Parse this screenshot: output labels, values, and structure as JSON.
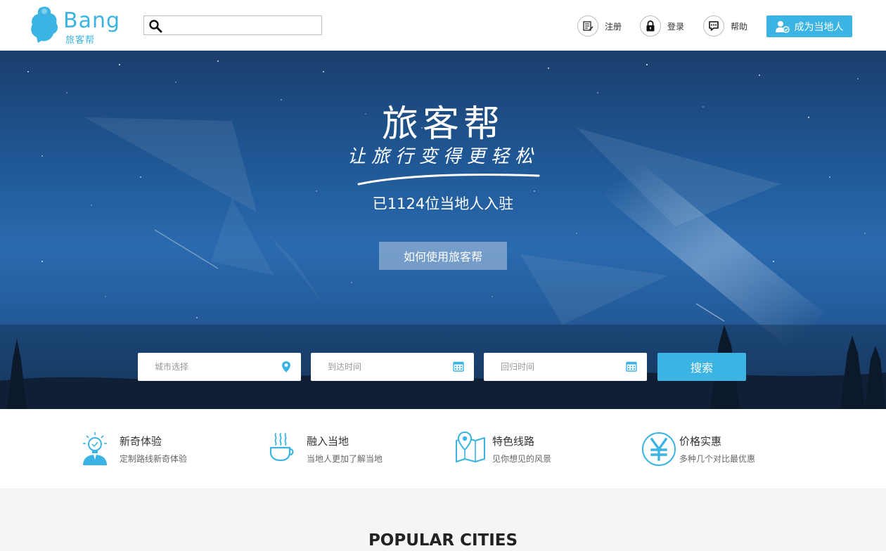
{
  "header": {
    "logo_word": "Bang",
    "logo_sub": "旅客帮",
    "search": {
      "value": "",
      "placeholder": ""
    },
    "nav": [
      {
        "label": "注册",
        "icon": "register-icon"
      },
      {
        "label": "登录",
        "icon": "lock-icon"
      },
      {
        "label": "帮助",
        "icon": "chat-icon"
      }
    ],
    "become_local_label": "成为当地人"
  },
  "hero": {
    "title": "旅客帮",
    "slogan": "让旅行变得更轻松",
    "local_count": "已1124位当地人入驻",
    "how_to_label": "如何使用旅客帮"
  },
  "search_form": {
    "city_placeholder": "城市选择",
    "arrive_placeholder": "到达时间",
    "return_placeholder": "回归时间",
    "submit_label": "搜索"
  },
  "features": [
    {
      "title": "新奇体验",
      "desc": "定制路线新奇体验",
      "icon": "lightbulb-person-icon"
    },
    {
      "title": "融入当地",
      "desc": "当地人更加了解当地",
      "icon": "coffee-cup-icon"
    },
    {
      "title": "特色线路",
      "desc": "见你想见的风景",
      "icon": "map-pin-icon"
    },
    {
      "title": "价格实惠",
      "desc": "多种几个对比最优惠",
      "icon": "yen-icon"
    }
  ],
  "popular_title": "POPULAR CITIES",
  "colors": {
    "accent": "#3bb4e3"
  }
}
